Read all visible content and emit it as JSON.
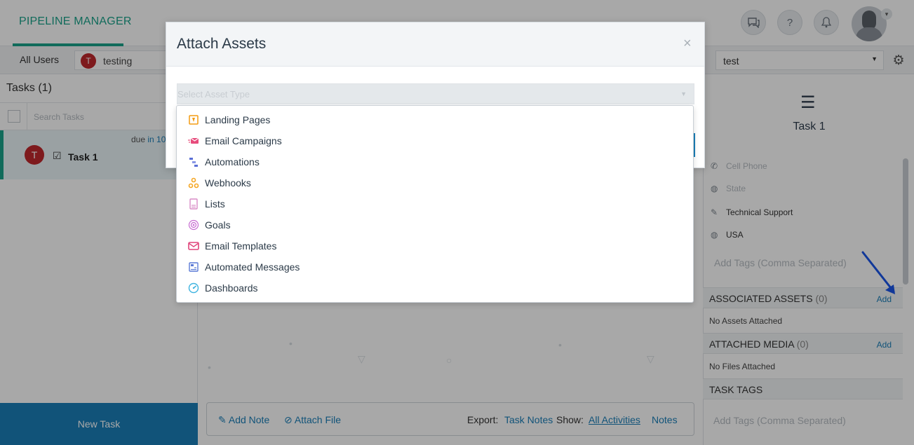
{
  "header": {
    "brand": "PIPELINE MANAGER",
    "icons": [
      "chat-icon",
      "help-icon",
      "bell-icon"
    ],
    "help_glyph": "?"
  },
  "subbar": {
    "all_users": "All Users",
    "user_initial": "T",
    "user_name": "testing",
    "pipeline_value": "test"
  },
  "tasks_panel": {
    "title": "Tasks (1)",
    "search_placeholder": "Search Tasks",
    "task": {
      "due_prefix": "due",
      "due_value": "in 10",
      "initial": "T",
      "name": "Task 1"
    },
    "new_task": "New Task"
  },
  "notes_bar": {
    "add_note": "Add Note",
    "attach_file": "Attach File",
    "export_label": "Export:",
    "export_task_notes": "Task Notes",
    "show_label": "Show:",
    "all_activities": "All Activities",
    "notes": "Notes"
  },
  "details": {
    "task_name": "Task 1",
    "props": [
      {
        "icon": "phone-icon",
        "text": "Cell Phone",
        "muted": true
      },
      {
        "icon": "globe-icon",
        "text": "State",
        "muted": true
      },
      {
        "icon": "edit-icon",
        "text": "Technical Support",
        "muted": false
      },
      {
        "icon": "globe-icon",
        "text": "USA",
        "muted": false
      }
    ],
    "tags_placeholder": "Add Tags (Comma Separated)",
    "associated_assets": {
      "title": "ASSOCIATED ASSETS",
      "count": "(0)",
      "add": "Add",
      "empty": "No Assets Attached"
    },
    "attached_media": {
      "title": "ATTACHED MEDIA",
      "count": "(0)",
      "add": "Add",
      "empty": "No Files Attached"
    },
    "task_tags": {
      "title": "TASK TAGS",
      "placeholder": "Add Tags (Comma Separated)"
    }
  },
  "modal": {
    "title": "Attach Assets",
    "close": "×",
    "select_placeholder": "Select Asset Type",
    "options": [
      {
        "label": "Landing Pages",
        "icon": "landing-pages-icon",
        "color": "#f39c12"
      },
      {
        "label": "Email Campaigns",
        "icon": "email-campaigns-icon",
        "color": "#e74c7c"
      },
      {
        "label": "Automations",
        "icon": "automations-icon",
        "color": "#5b6fd6"
      },
      {
        "label": "Webhooks",
        "icon": "webhooks-icon",
        "color": "#f5a623"
      },
      {
        "label": "Lists",
        "icon": "lists-icon",
        "color": "#d98cc6"
      },
      {
        "label": "Goals",
        "icon": "goals-icon",
        "color": "#c76bd1"
      },
      {
        "label": "Email Templates",
        "icon": "email-templates-icon",
        "color": "#e0457b"
      },
      {
        "label": "Automated Messages",
        "icon": "automated-messages-icon",
        "color": "#5b7bd6"
      },
      {
        "label": "Dashboards",
        "icon": "dashboards-icon",
        "color": "#3fb4e0"
      }
    ]
  },
  "colors": {
    "brand": "#1aa38a",
    "link": "#1a7fb8",
    "avatar_red": "#c0282d",
    "overlay": "rgba(0,0,0,0.34)"
  }
}
